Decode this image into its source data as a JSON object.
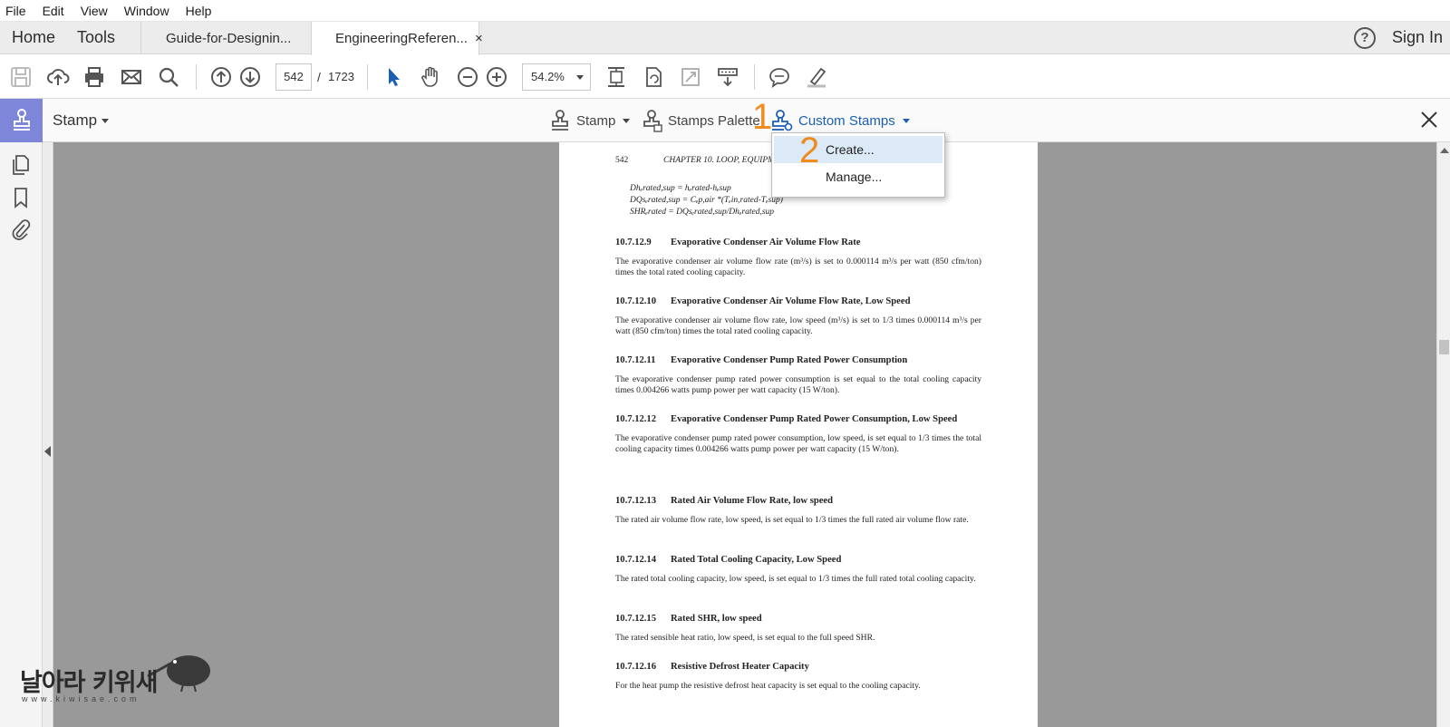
{
  "menu": {
    "file": "File",
    "edit": "Edit",
    "view": "View",
    "window": "Window",
    "help": "Help"
  },
  "tabs": {
    "home": "Home",
    "tools": "Tools",
    "doc1": "Guide-for-Designin...",
    "doc2": "EngineeringReferen...",
    "close_glyph": "×",
    "help_glyph": "?",
    "sign_in": "Sign In"
  },
  "toolbar": {
    "page_current": "542",
    "page_separator": "/",
    "page_total": "1723",
    "zoom": "54.2%",
    "icons": [
      "save-icon",
      "upload-icon",
      "print-icon",
      "email-icon",
      "search-icon",
      "page-up-icon",
      "page-down-icon",
      "select-arrow-icon",
      "hand-icon",
      "zoom-out-icon",
      "zoom-in-icon",
      "fit-page-icon",
      "rotate-icon",
      "fullscreen-icon",
      "scroll-mode-icon",
      "comment-icon",
      "highlight-icon"
    ]
  },
  "stampbar": {
    "title": "Stamp",
    "stamp_menu": "Stamp",
    "stamps_palette": "Stamps Palette",
    "custom_stamps": "Custom Stamps",
    "annotation_1": "1",
    "annotation_2": "2",
    "accent": "#7e86d9",
    "link_color": "#1a5fb4",
    "annotation_color": "#f08b1e"
  },
  "dropdown": {
    "create": "Create...",
    "manage": "Manage...",
    "highlight": "#dce9f7"
  },
  "document": {
    "page_number": "542",
    "chapter": "CHAPTER 10.   LOOP, EQUIPMENT S",
    "equations": [
      "Dhₑrated,sup = hₑrated-hₑsup",
      "DQsₑrated,sup = Cₑp,air *(Tₑin,rated-Tₑsup)",
      "SHRₑrated = DQsₑrated,sup/Dhₑrated,sup"
    ],
    "sections": [
      {
        "num": "10.7.12.9",
        "title": "Evaporative Condenser Air Volume Flow Rate",
        "body": "The evaporative condenser air volume flow rate (m³/s) is set to 0.000114 m³/s per watt (850 cfm/ton) times the total rated cooling capacity."
      },
      {
        "num": "10.7.12.10",
        "title": "Evaporative Condenser Air Volume Flow Rate, Low Speed",
        "body": "The evaporative condenser air volume flow rate, low speed (m³/s) is set to 1/3 times 0.000114 m³/s per watt (850 cfm/ton) times the total rated cooling capacity."
      },
      {
        "num": "10.7.12.11",
        "title": "Evaporative Condenser Pump Rated Power Consumption",
        "body": "The evaporative condenser pump rated power consumption is set equal to the total cooling capacity times 0.004266 watts pump power per watt capacity (15 W/ton)."
      },
      {
        "num": "10.7.12.12",
        "title": "Evaporative Condenser Pump Rated Power Consumption, Low Speed",
        "body": "The evaporative condenser pump rated power consumption, low speed, is set equal to 1/3 times the total cooling capacity times 0.004266 watts pump power per watt capacity (15 W/ton)."
      },
      {
        "num": "10.7.12.13",
        "title": "Rated Air Volume Flow Rate, low speed",
        "body": "The rated air volume flow rate, low speed, is set equal to 1/3 times the full rated air volume flow rate."
      },
      {
        "num": "10.7.12.14",
        "title": "Rated Total Cooling Capacity, Low Speed",
        "body": "The rated total cooling capacity, low speed, is set equal to 1/3 times the full rated total cooling capacity."
      },
      {
        "num": "10.7.12.15",
        "title": "Rated SHR, low speed",
        "body": "The rated sensible heat ratio, low speed, is set equal to the full speed SHR."
      },
      {
        "num": "10.7.12.16",
        "title": "Resistive Defrost Heater Capacity",
        "body": "For the heat pump the resistive defrost heat capacity is set equal to the cooling capacity."
      }
    ]
  },
  "watermark": {
    "text": "날아라 키위새",
    "url": "www.kiwisae.com"
  }
}
